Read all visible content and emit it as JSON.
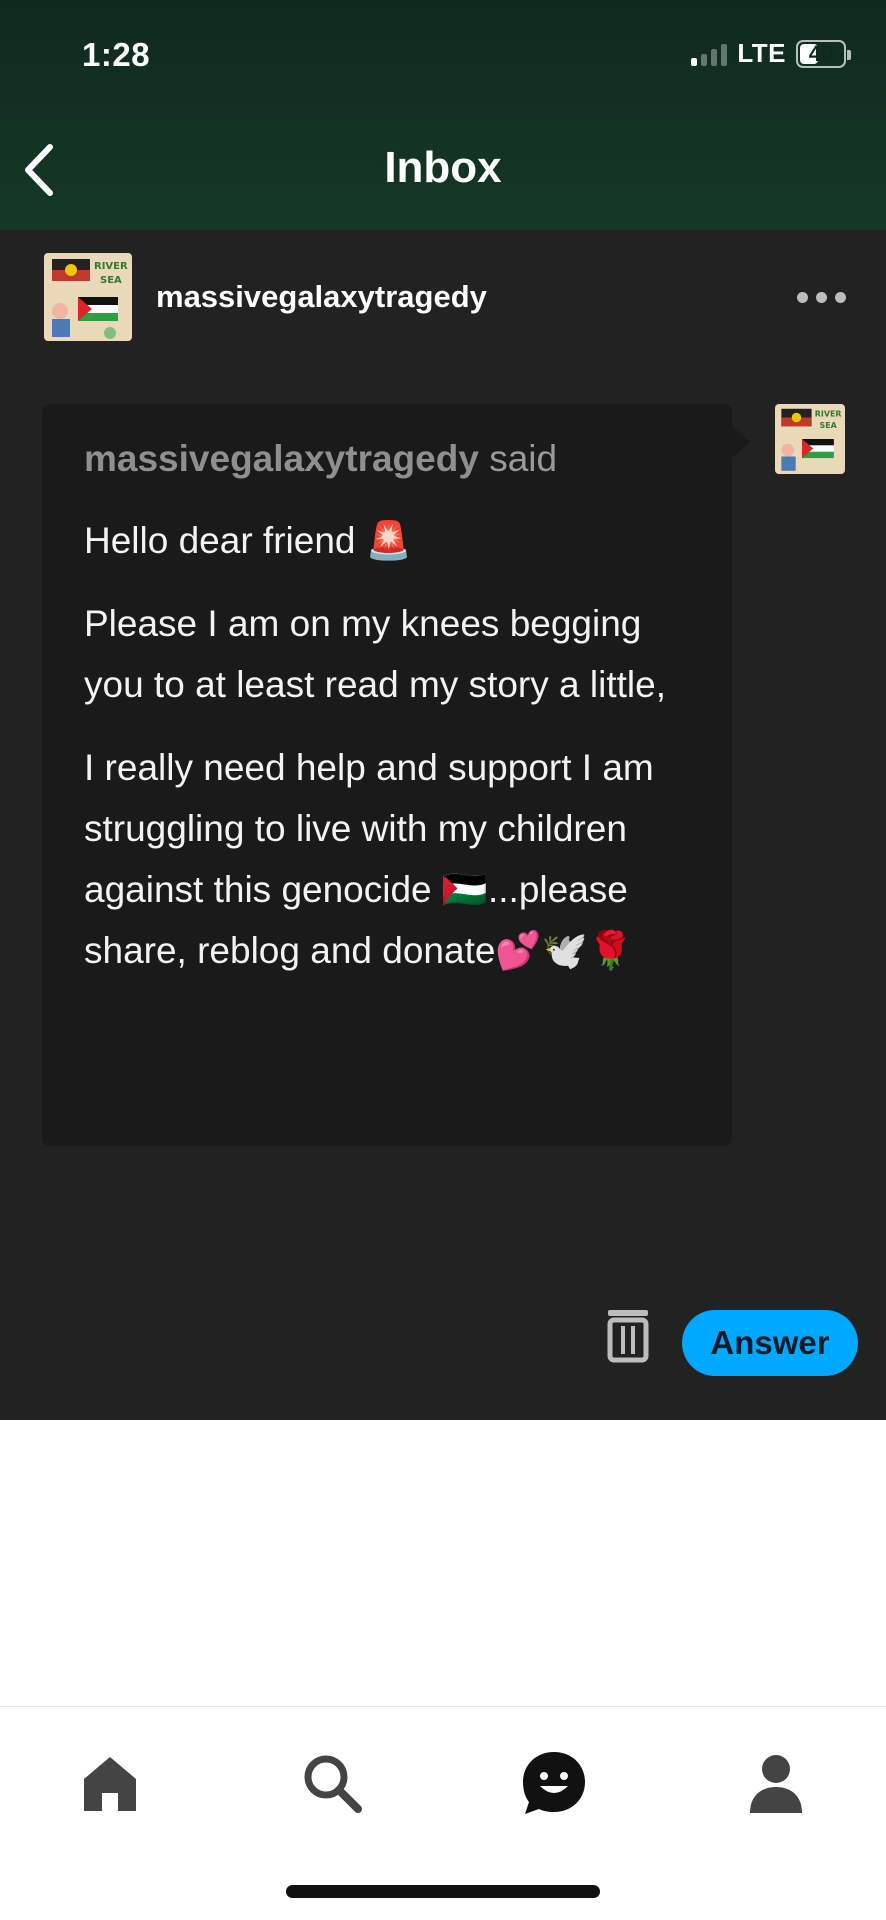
{
  "status": {
    "time": "1:28",
    "network": "LTE",
    "battery": "40"
  },
  "nav": {
    "title": "Inbox",
    "back_icon": "chevron-left-icon"
  },
  "sender": {
    "name": "massivegalaxytragedy",
    "more_icon": "more-horizontal-icon"
  },
  "message": {
    "author": "massivegalaxytragedy",
    "said": " said",
    "paragraphs": [
      "Hello dear friend 🚨",
      "Please I am on my knees begging you to at least read my story a little,",
      "I really need help and support I am struggling to live with my children against this genocide 🇵🇸...please share, reblog and donate💕🕊️🌹"
    ]
  },
  "actions": {
    "answer_label": "Answer",
    "delete_icon": "trash-icon"
  },
  "tabbar": {
    "items": [
      {
        "name": "home",
        "icon": "home-icon"
      },
      {
        "name": "search",
        "icon": "search-icon"
      },
      {
        "name": "activity",
        "icon": "smiley-chat-icon",
        "active": true
      },
      {
        "name": "account",
        "icon": "person-icon"
      }
    ]
  },
  "colors": {
    "header": "#153826",
    "panel": "#222222",
    "bubble": "#1a1a1a",
    "accent": "#00a8ff"
  }
}
